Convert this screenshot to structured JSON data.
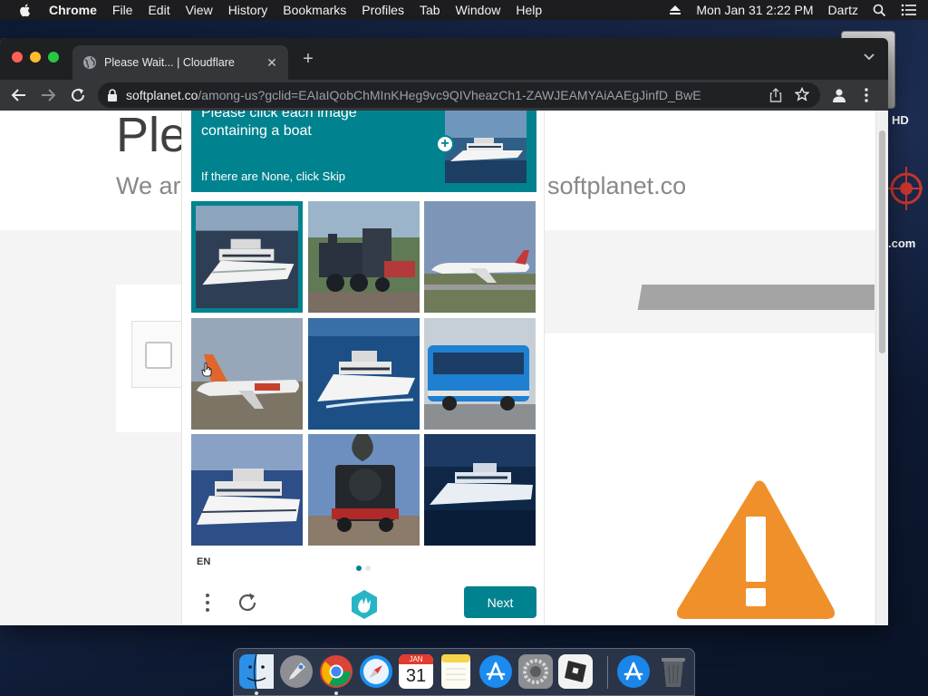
{
  "menubar": {
    "app_name": "Chrome",
    "items": [
      "File",
      "Edit",
      "View",
      "History",
      "Bookmarks",
      "Profiles",
      "Tab",
      "Window",
      "Help"
    ],
    "clock": "Mon Jan 31  2:22 PM",
    "user": "Dartz"
  },
  "desktop": {
    "hd_label": "HD",
    "domain_label": ".com"
  },
  "browser": {
    "tab_title": "Please Wait... | Cloudflare",
    "url_host": "softplanet.co",
    "url_path": "/among-us?gclid=EAIaIQobChMInKHeg9vc9QIVheazCh1-ZAWJEAMYAiAAEgJinfD_BwE"
  },
  "page": {
    "heading": "Ple",
    "subtitle_left": "We ar",
    "subtitle_right": "softplanet.co"
  },
  "captcha": {
    "prompt_line1": "Please click each image",
    "prompt_line2": "containing a boat",
    "prompt_sub": "If there are None, click Skip",
    "language": "EN",
    "next_label": "Next",
    "accent": "#00838f",
    "tiles": [
      {
        "subject": "yacht",
        "selected": true
      },
      {
        "subject": "train",
        "selected": false
      },
      {
        "subject": "airplane",
        "selected": false
      },
      {
        "subject": "airplane",
        "selected": false
      },
      {
        "subject": "yacht",
        "selected": false
      },
      {
        "subject": "bus",
        "selected": false
      },
      {
        "subject": "yacht",
        "selected": false
      },
      {
        "subject": "train",
        "selected": false
      },
      {
        "subject": "yacht",
        "selected": false
      }
    ]
  },
  "calendar": {
    "month": "JAN",
    "day": "31"
  },
  "colors": {
    "warning": "#f0902a",
    "menubar_bg": "#1d1d1f"
  }
}
